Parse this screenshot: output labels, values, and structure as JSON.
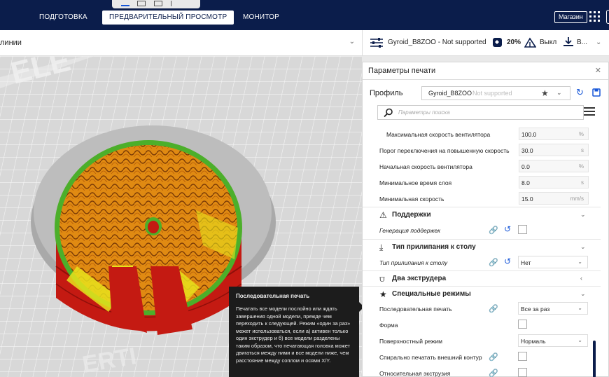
{
  "stages": {
    "prepare": "ПОДГОТОВКА",
    "preview": "ПРЕДВАРИТЕЛЬНЫЙ ПРОСМОТР",
    "monitor": "МОНИТОР"
  },
  "topbar": {
    "marketplace": "Магазин"
  },
  "view_header": {
    "label": "линии"
  },
  "print_setup": {
    "profile_summary": "Gyroid_B8ZOO - Not supported",
    "infill": "20%",
    "support": "Выкл",
    "adhesion": "В..."
  },
  "panel": {
    "title": "Параметры печати",
    "profile_label": "Профиль",
    "profile_name": "Gyroid_B8ZOO",
    "profile_status": "Not supported",
    "search_placeholder": "Параметры поиска"
  },
  "settings": {
    "cooling": [
      {
        "label": "Максимальная скорость вентилятора",
        "value": "100.0",
        "unit": "%"
      },
      {
        "label": "Порог переключения на повышенную скорость",
        "value": "30.0",
        "unit": "s"
      },
      {
        "label": "Начальная скорость вентилятора",
        "value": "0.0",
        "unit": "%"
      },
      {
        "label": "Минимальное время слоя",
        "value": "8.0",
        "unit": "s"
      },
      {
        "label": "Минимальная скорость",
        "value": "15.0",
        "unit": "mm/s"
      }
    ],
    "support_cat": "Поддержки",
    "support_gen": "Генерация поддержек",
    "adhesion_cat": "Тип прилипания к столу",
    "adhesion_type": "Тип прилипания к столу",
    "adhesion_value": "Нет",
    "dual_cat": "Два экструдера",
    "special_cat": "Специальные режимы",
    "special": {
      "sequence": "Последовательная печать",
      "sequence_value": "Все за раз",
      "mold": "Форма",
      "surface": "Поверхностный режим",
      "surface_value": "Нормаль",
      "spiralize": "Спирально печатать внешний контур",
      "relative": "Относительная экструзия"
    }
  },
  "tooltip": {
    "title": "Последовательная печать",
    "body": "Печатать все модели послойно или ждать завершения одной модели, прежде чем переходить к следующей. Режим «один за раз» может использоваться, если а) активен только один экструдер и б) все модели разделены таким образом, что печатающая головка может двигаться между ними и все модели ниже, чем расстояние между соплом и осями X/Y."
  },
  "colors": {
    "topbar": "#0b1d4b",
    "accent": "#1656d8",
    "infill": "#e08a12",
    "skin": "#e8e21c",
    "support_green": "#4caf2a",
    "wall": "#c41a12"
  }
}
